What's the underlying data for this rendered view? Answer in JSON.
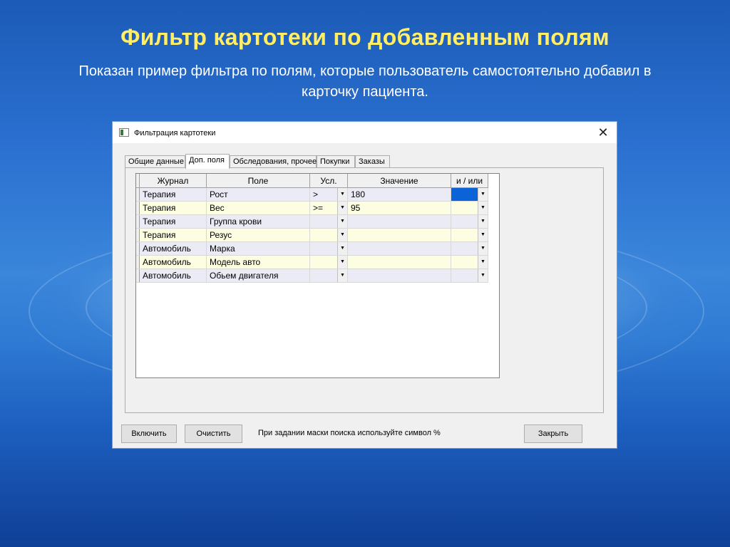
{
  "slide": {
    "title": "Фильтр картотеки по добавленным полям",
    "subtitle": "Показан пример фильтра по полям, которые пользователь самостоятельно добавил в карточку пациента."
  },
  "window": {
    "title": "Фильтрация картотеки",
    "close_icon": "close-icon"
  },
  "tabs": [
    {
      "label": "Общие данные",
      "active": false
    },
    {
      "label": "Доп. поля",
      "active": true
    },
    {
      "label": "Обследования, прочее",
      "active": false
    },
    {
      "label": "Покупки",
      "active": false
    },
    {
      "label": "Заказы",
      "active": false
    }
  ],
  "grid": {
    "columns": [
      "Журнал",
      "Поле",
      "Усл.",
      "Значение",
      "и / или"
    ],
    "rows": [
      {
        "journal": "Терапия",
        "field": "Рост",
        "cond": ">",
        "value": "180",
        "andor": ""
      },
      {
        "journal": "Терапия",
        "field": "Вес",
        "cond": ">=",
        "value": "95",
        "andor": ""
      },
      {
        "journal": "Терапия",
        "field": "Группа крови",
        "cond": "",
        "value": "",
        "andor": ""
      },
      {
        "journal": "Терапия",
        "field": "Резус",
        "cond": "",
        "value": "",
        "andor": ""
      },
      {
        "journal": "Автомобиль",
        "field": "Марка",
        "cond": "",
        "value": "",
        "andor": ""
      },
      {
        "journal": "Автомобиль",
        "field": "Модель авто",
        "cond": "",
        "value": "",
        "andor": ""
      },
      {
        "journal": "Автомобиль",
        "field": "Обьем двигателя",
        "cond": "",
        "value": "",
        "andor": ""
      }
    ]
  },
  "footer": {
    "include_label": "Включить",
    "clear_label": "Очистить",
    "hint": "При задании маски поиска используйте символ %",
    "close_label": "Закрыть"
  },
  "colors": {
    "title": "#ffee66",
    "selection": "#0a64d8",
    "row_odd": "#ebebf6",
    "row_even": "#fdfde2"
  }
}
